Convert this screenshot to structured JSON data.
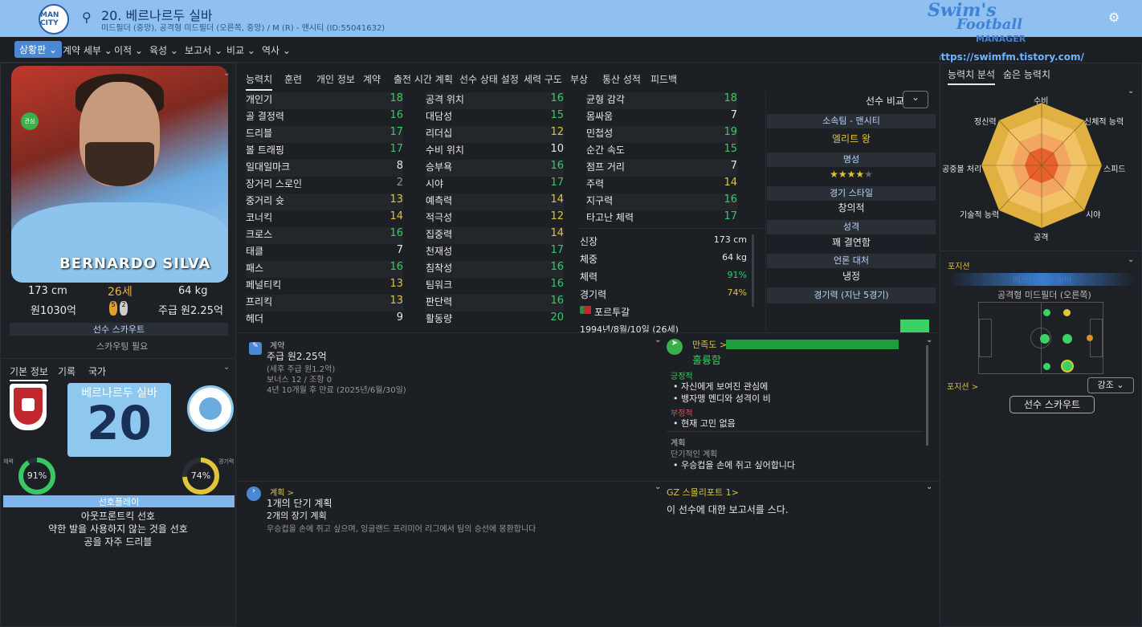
{
  "header": {
    "title": "20. 베르나르두 실바",
    "subtitle": "미드필더 (중앙), 공격형 미드필더 (오른쪽, 중앙) / M (R) - 맨시티 (ID:55041632)",
    "club_badge": "MAN CITY"
  },
  "site": {
    "logo_line1": "Swim's",
    "logo_line2": "Football",
    "logo_line3": "MANAGER",
    "url": "https://swimfm.tistory.com/"
  },
  "menu": [
    "상황판",
    "계약 세부",
    "이적",
    "육성",
    "보고서",
    "비교",
    "역사"
  ],
  "player": {
    "name_on_photo": "BERNARDO SILVA",
    "badge": "관심",
    "height": "173 cm",
    "age": "26세",
    "weight": "64 kg",
    "value": "원1030억",
    "wage": "주급 원2.25억",
    "feet": [
      "5",
      "2"
    ],
    "scout_header": "선수 스카우트",
    "scout_status": "스카우팅 필요"
  },
  "left_tabs": [
    "기본 정보",
    "기록",
    "국가"
  ],
  "shirt": {
    "name": "베르나르두 실바",
    "number": "20"
  },
  "gauges": {
    "left_label": "체력",
    "left_value": "91%",
    "left_pct": 91,
    "right_label": "경기력",
    "right_value": "74%",
    "right_pct": 74
  },
  "preferred": {
    "header": "선호플레이",
    "items": [
      "아웃프론트킥 선호",
      "약한 발을 사용하지 않는 것을 선호",
      "공을 자주 드리블"
    ]
  },
  "tabs": [
    "능력치",
    "훈련",
    "개인 정보",
    "계약",
    "출전 시간 계획",
    "선수 상태 설정",
    "세력 구도",
    "부상",
    "통산 성적",
    "피드백"
  ],
  "attrs": {
    "col1": [
      [
        "개인기",
        "18",
        "g"
      ],
      [
        "골 결정력",
        "16",
        "g"
      ],
      [
        "드리블",
        "17",
        "g"
      ],
      [
        "볼 트래핑",
        "17",
        "g"
      ],
      [
        "일대일마크",
        "8",
        "w"
      ],
      [
        "장거리 스로인",
        "2",
        "gr"
      ],
      [
        "중거리 슛",
        "13",
        "y"
      ],
      [
        "코너킥",
        "14",
        "y"
      ],
      [
        "크로스",
        "16",
        "g"
      ],
      [
        "태클",
        "7",
        "w"
      ],
      [
        "패스",
        "16",
        "g"
      ],
      [
        "페널티킥",
        "13",
        "y"
      ],
      [
        "프리킥",
        "13",
        "y"
      ],
      [
        "헤더",
        "9",
        "w"
      ]
    ],
    "col2": [
      [
        "공격 위치",
        "16",
        "g"
      ],
      [
        "대담성",
        "15",
        "g"
      ],
      [
        "리더십",
        "12",
        "y"
      ],
      [
        "수비 위치",
        "10",
        "w"
      ],
      [
        "승부욕",
        "16",
        "g"
      ],
      [
        "시야",
        "17",
        "g"
      ],
      [
        "예측력",
        "14",
        "y"
      ],
      [
        "적극성",
        "12",
        "y"
      ],
      [
        "집중력",
        "14",
        "y"
      ],
      [
        "천재성",
        "17",
        "g"
      ],
      [
        "침착성",
        "16",
        "g"
      ],
      [
        "팀워크",
        "16",
        "g"
      ],
      [
        "판단력",
        "16",
        "g"
      ],
      [
        "활동량",
        "20",
        "g"
      ]
    ],
    "col3": [
      [
        "균형 감각",
        "18",
        "g"
      ],
      [
        "몸싸움",
        "7",
        "w"
      ],
      [
        "민첩성",
        "19",
        "g"
      ],
      [
        "순간 속도",
        "15",
        "g"
      ],
      [
        "점프 거리",
        "7",
        "w"
      ],
      [
        "주력",
        "14",
        "y"
      ],
      [
        "지구력",
        "16",
        "g"
      ],
      [
        "타고난 체력",
        "17",
        "g"
      ]
    ]
  },
  "physical": [
    [
      "신장",
      "173 cm"
    ],
    [
      "체중",
      "64 kg"
    ],
    [
      "체력",
      "91%"
    ],
    [
      "경기력",
      "74%"
    ]
  ],
  "nation": "포르투갈",
  "birth": "1994년/8월/10일 (26세)",
  "side": {
    "compare": "선수 비교",
    "club_header": "소속팀 - 맨시티",
    "club_status": "엘리트 왕",
    "rep_header": "명성",
    "stars": "★★★★",
    "star_empty": "★",
    "style_header": "경기 스타일",
    "style": "창의적",
    "pers_header": "성격",
    "pers": "꽤 결연함",
    "media_header": "언론 대처",
    "media": "냉정",
    "form_header": "경기력 (지난 5경기)"
  },
  "contract": {
    "label": "계약",
    "wage": "주급 원2.25억",
    "tax": "(세후 주급 원1.2억)",
    "bonus": "보너스 12 / 조항 0",
    "expire": "4년 10개월 후 만료 (2025년/6월/30일)"
  },
  "happiness": {
    "label": "만족도 >",
    "status": "훌륭함",
    "pos_header": "긍정적",
    "pos": [
      "자신에게 보여진 관심에",
      "뱅자맹 멘디와 성격이 비"
    ],
    "neg_header": "부정적",
    "neg": [
      "현재 고민 없음"
    ],
    "plan_header": "계획",
    "plan_sub": "단기적인 계획",
    "plan": [
      "우승컵을 손에 쥐고 싶어합니다"
    ]
  },
  "plans": {
    "label": "계획 >",
    "short": "1개의 단기 계획",
    "long": "2개의 장기 계획",
    "desc": "우승컵을 손에 쥐고 싶으며, 잉글랜드 프리미어 리그에서 팀의 승선에 몽환합니다"
  },
  "report": {
    "label": "GZ 스몰리포트 1>",
    "text": "이 선수에 대한 보고서를 스다."
  },
  "right": {
    "tabs": [
      "능력치 분석",
      "숨은 능력치"
    ],
    "radar": [
      "수비",
      "신체적 능력",
      "스피드",
      "시야",
      "공격",
      "기술적 능력",
      "공중볼 처리",
      "정신력"
    ],
    "pos_header": "포지션",
    "pos_main": "베르나르두 실바",
    "pos_role": "공격형 미드필더 (오른쪽)",
    "pos_link": "포지션 >",
    "emphasis": "강조",
    "scout_btn": "선수 스카우트"
  }
}
